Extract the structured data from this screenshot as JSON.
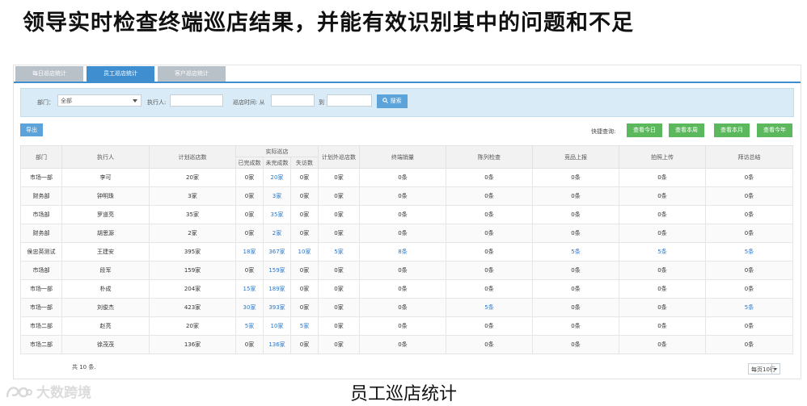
{
  "headline": "领导实时检查终端巡店结果，并能有效识别其中的问题和不足",
  "tabs": [
    "每日巡店统计",
    "员工巡店统计",
    "客户巡店统计"
  ],
  "active_tab": "员工巡店统计",
  "filter": {
    "dept_label": "部门：",
    "dept_value": "全部",
    "executor_label": "执行人:",
    "executor_value": "",
    "time_label": "巡店时间: 从",
    "time_from": "",
    "to_label": "到",
    "time_to": "",
    "search_label": "搜索"
  },
  "toolbar": {
    "export_label": "导出",
    "quick_label": "快捷查询:",
    "quick_buttons": [
      "查看今日",
      "查看本周",
      "查看本月",
      "查看今年"
    ]
  },
  "table": {
    "headers": [
      "部门",
      "执行人",
      "计划巡店数",
      "实际巡店",
      "计划外巡店数",
      "终端销量",
      "陈列检查",
      "竞品上报",
      "拍照上传",
      "拜访总结"
    ],
    "subheaders": [
      "已完成数",
      "未完成数",
      "失访数"
    ],
    "rows": [
      [
        "市场一部",
        "李可",
        "20家",
        "0家",
        "20家",
        "0家",
        "0家",
        "0条",
        "0条",
        "0条",
        "0条",
        "0条"
      ],
      [
        "财务部",
        "钟明珠",
        "3家",
        "0家",
        "3家",
        "0家",
        "0家",
        "0条",
        "0条",
        "0条",
        "0条",
        "0条"
      ],
      [
        "市场部",
        "罗道亮",
        "35家",
        "0家",
        "35家",
        "0家",
        "0家",
        "0条",
        "0条",
        "0条",
        "0条",
        "0条"
      ],
      [
        "财务部",
        "胡思源",
        "2家",
        "0家",
        "2家",
        "0家",
        "0家",
        "0条",
        "0条",
        "0条",
        "0条",
        "0条"
      ],
      [
        "侯忠英测试",
        "王建安",
        "395家",
        "18家",
        "367家",
        "10家",
        "5家",
        "8条",
        "0条",
        "5条",
        "5条",
        "5条"
      ],
      [
        "市场部",
        "段军",
        "159家",
        "0家",
        "159家",
        "0家",
        "0家",
        "0条",
        "0条",
        "0条",
        "0条",
        "0条"
      ],
      [
        "市场一部",
        "朴成",
        "204家",
        "15家",
        "189家",
        "0家",
        "0家",
        "0条",
        "0条",
        "0条",
        "0条",
        "0条"
      ],
      [
        "市场一部",
        "刘俊杰",
        "423家",
        "30家",
        "393家",
        "0家",
        "0家",
        "0条",
        "5条",
        "0条",
        "0条",
        "5条"
      ],
      [
        "市场二部",
        "赵亮",
        "20家",
        "5家",
        "10家",
        "5家",
        "0家",
        "0条",
        "0条",
        "0条",
        "0条",
        "0条"
      ],
      [
        "市场二部",
        "徐茂茂",
        "136家",
        "0家",
        "136家",
        "0家",
        "0家",
        "0条",
        "0条",
        "0条",
        "0条",
        "0条"
      ]
    ]
  },
  "footer": {
    "total": "共 10 条.",
    "page_size": "每页10行"
  },
  "watermark": "大数跨境",
  "caption": "员工巡店统计"
}
